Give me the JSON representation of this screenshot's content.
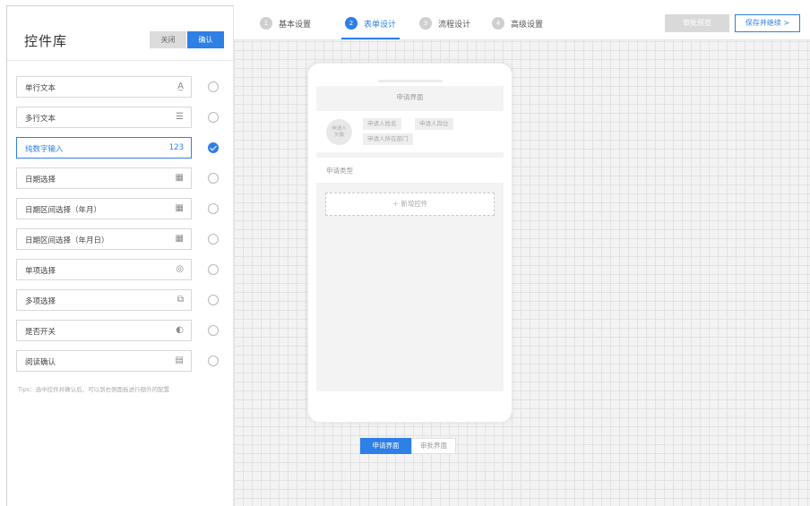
{
  "left_panel": {
    "title": "控件库",
    "close_label": "关闭",
    "confirm_label": "确认",
    "controls": [
      {
        "label": "单行文本",
        "icon": "text-a-icon",
        "glyph": "A̲",
        "selected": false
      },
      {
        "label": "多行文本",
        "icon": "multiline-icon",
        "glyph": "☰",
        "selected": false
      },
      {
        "label": "纯数字输入",
        "icon": "number-icon",
        "glyph": "123",
        "selected": true
      },
      {
        "label": "日期选择",
        "icon": "calendar-icon",
        "glyph": "▦",
        "selected": false
      },
      {
        "label": "日期区间选择（年月）",
        "icon": "calendar-range-icon",
        "glyph": "▦",
        "selected": false
      },
      {
        "label": "日期区间选择（年月日）",
        "icon": "calendar-range-icon",
        "glyph": "▦",
        "selected": false
      },
      {
        "label": "单项选择",
        "icon": "single-choice-icon",
        "glyph": "◎",
        "selected": false
      },
      {
        "label": "多项选择",
        "icon": "multi-choice-icon",
        "glyph": "⧉",
        "selected": false
      },
      {
        "label": "是否开关",
        "icon": "toggle-icon",
        "glyph": "◐",
        "selected": false
      },
      {
        "label": "阅读确认",
        "icon": "read-confirm-icon",
        "glyph": "▤",
        "selected": false
      }
    ],
    "tips": "Tips：选中控件并确认后，可以到右侧面板进行额外的配置"
  },
  "steps": [
    {
      "num": "1",
      "label": "基本设置",
      "active": false
    },
    {
      "num": "2",
      "label": "表单设计",
      "active": true
    },
    {
      "num": "3",
      "label": "流程设计",
      "active": false
    },
    {
      "num": "4",
      "label": "高级设置",
      "active": false
    }
  ],
  "toolbar": {
    "preview_label": "审批预览",
    "save_label": "保存并继续  >"
  },
  "phone": {
    "screen_title": "申请界面",
    "avatar_text": "申请人\n头像",
    "tags": [
      "申请人姓名",
      "申请人岗位",
      "申请人所在部门"
    ],
    "apply_type": "申请类型",
    "add_control": "＋ 新增控件"
  },
  "segments": {
    "apply": "申请界面",
    "approve": "审批界面"
  },
  "colors": {
    "accent": "#2e7fe6",
    "muted": "#d9d9d9"
  }
}
